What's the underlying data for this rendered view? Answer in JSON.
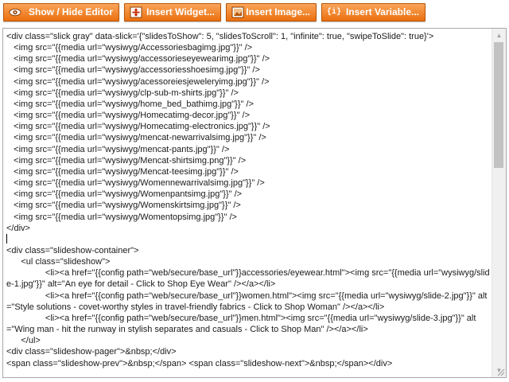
{
  "toolbar": {
    "show_hide_label": "Show / Hide Editor",
    "widget_label": "Insert Widget...",
    "image_label": "Insert Image...",
    "variable_label": "Insert Variable...",
    "variable_icon_text": "{i}"
  },
  "editor": {
    "lines": [
      "<div class=\"slick gray\" data-slick='{\"slidesToShow\": 5, \"slidesToScroll\": 1, \"infinite\": true, \"swipeToSlide\": true}'>",
      "   <img src=\"{{media url=\"wysiwyg/Accessoriesbagimg.jpg\"}}\" />",
      "   <img src=\"{{media url=\"wysiwyg/accessorieseyewearimg.jpg\"}}\" />",
      "   <img src=\"{{media url=\"wysiwyg/accessoriesshoesimg.jpg\"}}\" />",
      "   <img src=\"{{media url=\"wysiwyg/acessoreiesjeweleryimg.jpg\"}}\" />",
      "   <img src=\"{{media url=\"wysiwyg/clp-sub-m-shirts.jpg\"}}\" />",
      "   <img src=\"{{media url=\"wysiwyg/home_bed_bathimg.jpg\"}}\" />",
      "   <img src=\"{{media url=\"wysiwyg/Homecatimg-decor.jpg\"}}\" />",
      "   <img src=\"{{media url=\"wysiwyg/Homecatimg-electronics.jpg\"}}\" />",
      "   <img src=\"{{media url=\"wysiwyg/mencat-newarrivalsimg.jpg\"}}\" />",
      "   <img src=\"{{media url=\"wysiwyg/mencat-pants.jpg\"}}\" />",
      "   <img src=\"{{media url=\"wysiwyg/Mencat-shirtsimg.png\"}}\" />",
      "   <img src=\"{{media url=\"wysiwyg/Mencat-teesimg.jpg\"}}\" />",
      "   <img src=\"{{media url=\"wysiwyg/Womennewarrivalsimg.jpg\"}}\" />",
      "   <img src=\"{{media url=\"wysiwyg/Womenpantsimg.jpg\"}}\" />",
      "   <img src=\"{{media url=\"wysiwyg/Womenskirtsimg.jpg\"}}\" />",
      "   <img src=\"{{media url=\"wysiwyg/Womentopsimg.jpg\"}}\" />",
      "</div>",
      "",
      "<div class=\"slideshow-container\">",
      "      <ul class=\"slideshow\">",
      "                <li><a href=\"{{config path=\"web/secure/base_url\"}}accessories/eyewear.html\"><img src=\"{{media url=\"wysiwyg/slide-1.jpg\"}}\" alt=\"An eye for detail - Click to Shop Eye Wear\" /></a></li>",
      "                <li><a href=\"{{config path=\"web/secure/base_url\"}}women.html\"><img src=\"{{media url=\"wysiwyg/slide-2.jpg\"}}\" alt=\"Style solutions - covet-worthy styles in travel-friendly fabrics - Click to Shop Woman\" /></a></li>",
      "                <li><a href=\"{{config path=\"web/secure/base_url\"}}men.html\"><img src=\"{{media url=\"wysiwyg/slide-3.jpg\"}}\" alt=\"Wing man - hit the runway in stylish separates and casuals - Click to Shop Man\" /></a></li>",
      "      </ul>",
      "<div class=\"slideshow-pager\">&nbsp;</div>",
      "<span class=\"slideshow-prev\">&nbsp;</span> <span class=\"slideshow-next\">&nbsp;</span></div>"
    ]
  }
}
